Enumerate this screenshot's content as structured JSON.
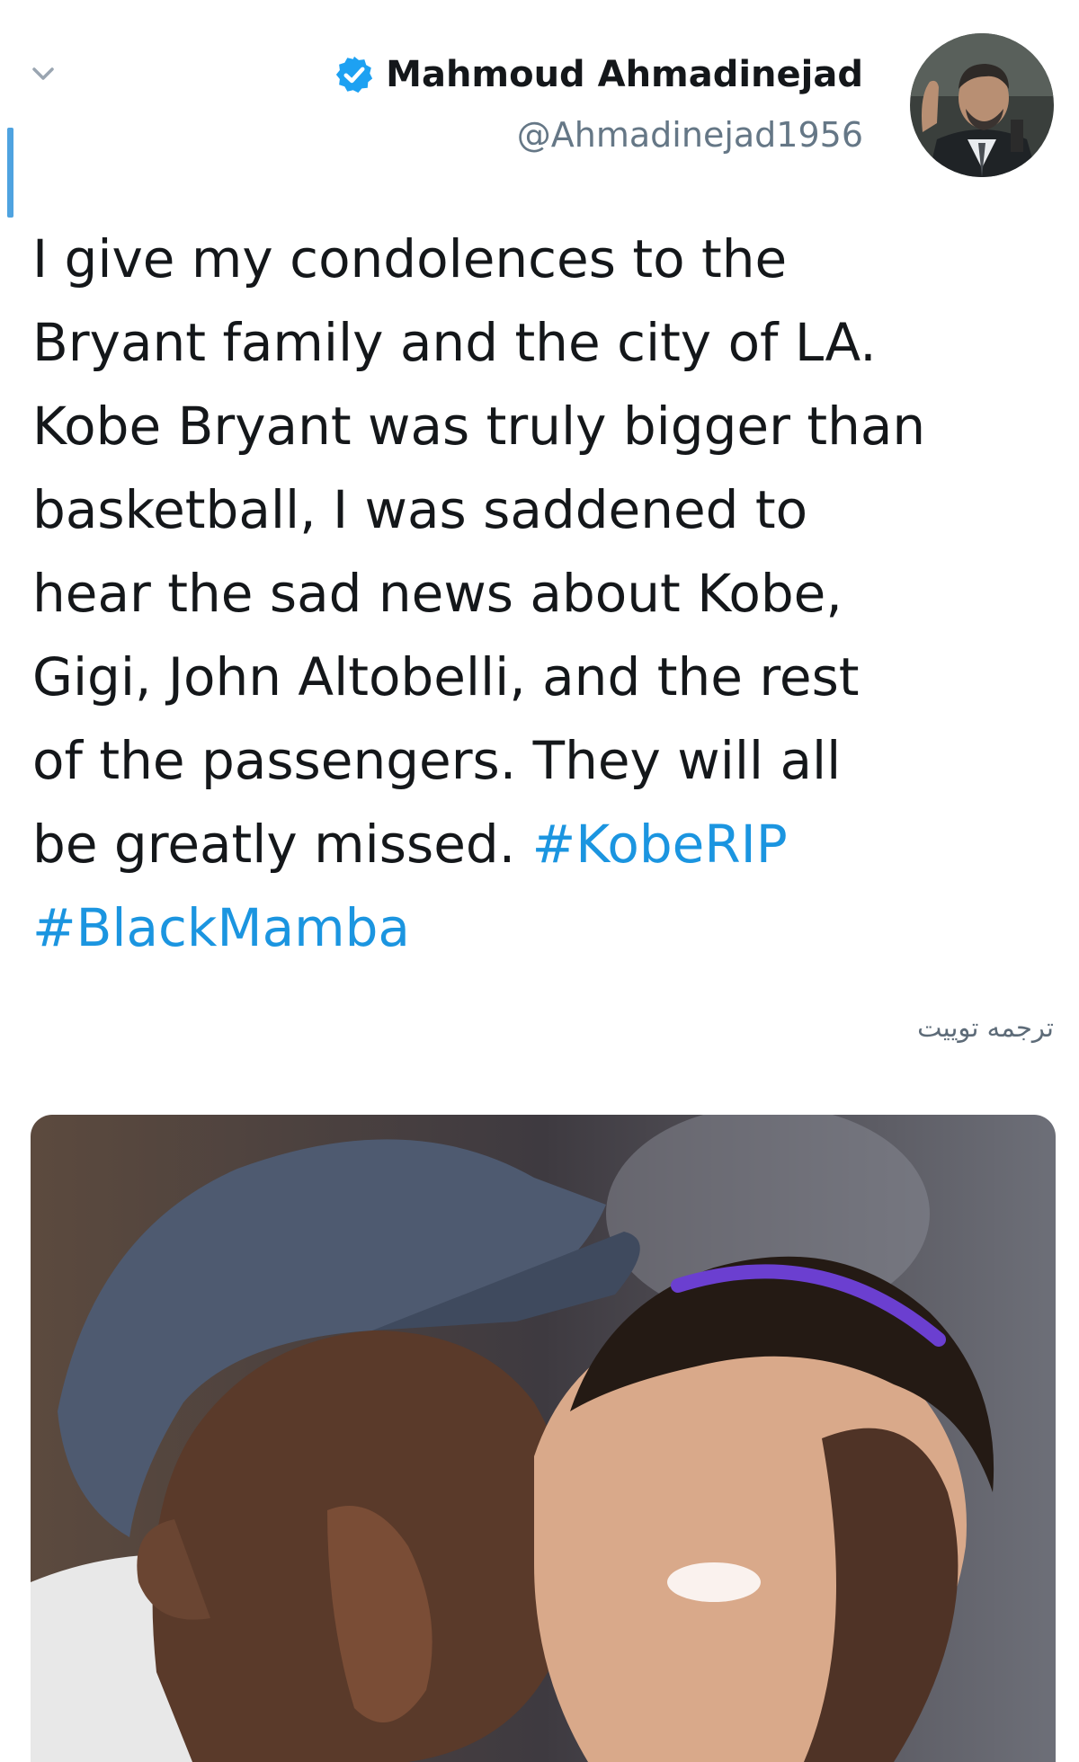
{
  "tweet": {
    "author": {
      "display_name": "Mahmoud Ahmadinejad",
      "handle": "@Ahmadinejad1956",
      "verified_icon": "verified-badge-icon",
      "avatar_icon": "profile-photo"
    },
    "text": "I give my condolences to the\nBryant family and the city of LA.\nKobe Bryant was truly bigger than\nbasketball, I was saddened to\nhear the sad news about Kobe,\nGigi, John Altobelli, and the rest\nof the passengers. They will all\nbe greatly missed. ",
    "hashtags": [
      "#KobeRIP",
      "#BlackMamba"
    ],
    "translate_label": "ترجمه توییت",
    "menu_icon": "chevron-down-icon",
    "media_icon": "tweet-photo"
  },
  "colors": {
    "text": "#14171a",
    "secondary": "#657786",
    "link": "#1b95e0",
    "verified": "#1da1f2",
    "accent_bar": "#4fa3e0"
  }
}
